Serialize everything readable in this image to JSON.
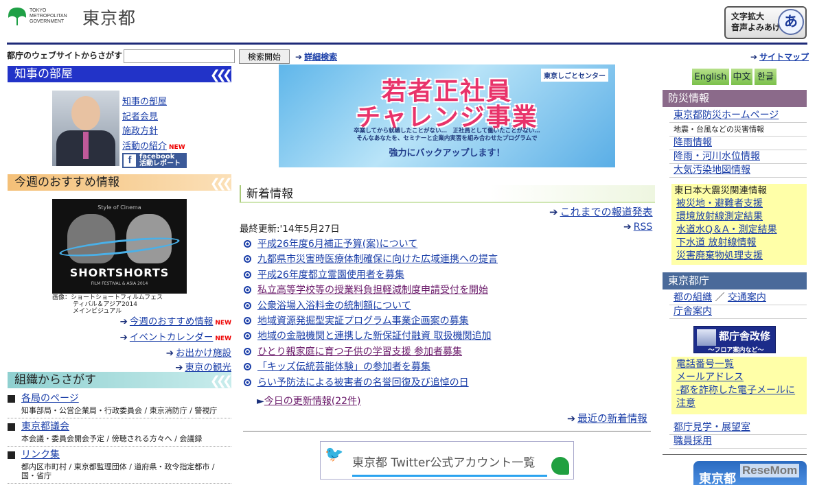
{
  "header": {
    "logo_en_lines": [
      "TOKYO",
      "METROPOLITAN",
      "GOVERNMENT"
    ],
    "logo_jp": "東京都",
    "a11y_line1": "文字拡大",
    "a11y_line2": "音声よみあげ",
    "a11y_icon": "あ"
  },
  "search": {
    "label": "都庁のウェブサイトからさがす",
    "placeholder": "",
    "button": "検索開始",
    "advanced": "詳細検索",
    "sitemap": "サイトマップ"
  },
  "governor": {
    "heading": "知事の部屋",
    "links": [
      "知事の部屋",
      "記者会見",
      "施政方針",
      "活動の紹介"
    ],
    "new_badge": "NEW",
    "facebook_l1": "facebook",
    "facebook_l2": "活動レポート"
  },
  "weekly": {
    "heading": "今週のおすすめ情報",
    "ad_top": "Style of Cinema",
    "ad_title": "SHORTSHORTS",
    "ad_sub": "FILM FESTIVAL & ASIA 2014",
    "caption_l1": "画像：ショートショートフィルムフェス",
    "caption_l2": "ティバル＆アジア2014",
    "caption_l3": "メインビジュアル",
    "links": [
      "今週のおすすめ情報",
      "イベントカレンダー",
      "お出かけ施設",
      "東京の観光"
    ],
    "new_badge": "NEW"
  },
  "org": {
    "heading": "組織からさがす",
    "items": [
      {
        "title": "各局のページ",
        "sub": "知事部局・公営企業局・行政委員会 / 東京消防庁 / 警視庁"
      },
      {
        "title": "東京都議会",
        "sub": "本会議・委員会開会予定 / 傍聴される方々へ / 会議録"
      },
      {
        "title": "リンク集",
        "sub": "都内区市町村 / 東京都監理団体 / 道府県・政令指定都市 / 国・省庁"
      }
    ]
  },
  "banner": {
    "logo": "東京しごとセンター",
    "line1": "若者正社員",
    "line2": "チャレンジ事業",
    "small1": "卒業してから就職したことがない…　正社員として働いたことがない…",
    "small2": "そんなあなたを、セミナーと企業内実習を組み合わせたプログラムで",
    "big": "強力にバックアップします！"
  },
  "news": {
    "heading": "新着情報",
    "past_link": "これまでの報道発表",
    "updated": "最終更新:'14年5月27日",
    "rss": "RSS",
    "items": [
      "平成26年度6月補正予算(案)について",
      "九都県市災害時医療体制確保に向けた広域連携への提言",
      "平成26年度都立霊園使用者を募集",
      "私立高等学校等の授業料負担軽減制度申請受付を開始",
      "公衆浴場入浴料金の統制額について",
      "地域資源発掘型実証プログラム事業企画案の募集",
      "地域の金融機関と連携した新保証付融資 取扱機関追加",
      "ひとり親家庭に育つ子供の学習支援 参加者募集",
      "「キッズ伝統芸能体験」の参加者を募集",
      "らい予防法による被害者の名誉回復及び追悼の日"
    ],
    "today": "今日の更新情報(22件)",
    "recent": "最近の新着情報"
  },
  "twitter": {
    "label": "東京都 Twitter公式アカウント一覧"
  },
  "right": {
    "langs": [
      "English",
      "中文",
      "한글"
    ],
    "disaster_heading": "防災情報",
    "disaster_links": [
      "東京都防災ホームページ",
      "地震・台風などの災害情報",
      "降雨情報",
      "降雨・河川水位情報",
      "大気汚染地図情報"
    ],
    "quake_title": "東日本大震災関連情報",
    "quake_links": [
      "被災地・避難者支援",
      "環境放射線測定結果",
      "水道水Q＆A・測定結果",
      "下水道 放射線情報",
      "災害廃棄物処理支援"
    ],
    "govoffice_heading": "東京都庁",
    "govoffice_links_a": "都の組織",
    "govoffice_sep": "／",
    "govoffice_links_b": "交通案内",
    "govoffice_link_c": "庁舎案内",
    "kaisyu_title": "都庁舎改修",
    "kaisyu_sub": "～フロア案内など～",
    "contact_links": [
      "電話番号一覧",
      "メールアドレス",
      "-都を詐称した電子メールに",
      "注意"
    ],
    "tour_links": [
      "都庁見学・展望室",
      "職員採用"
    ],
    "bottom_logo": "東京都",
    "watermark": "ReseMom"
  },
  "colors": {
    "governor_bar": "#2233c8",
    "weekly_bar": "#f4c078",
    "org_bar": "#8fd0d0",
    "disaster_bar": "#8b6a8a",
    "office_bar": "#4a6a9a",
    "header_rule": "#1e2a78"
  }
}
